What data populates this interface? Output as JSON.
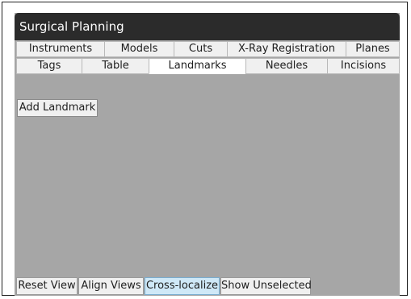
{
  "window": {
    "title": "Surgical Planning"
  },
  "tabs": {
    "row1": [
      {
        "label": "Instruments"
      },
      {
        "label": "Models"
      },
      {
        "label": "Cuts"
      },
      {
        "label": "X-Ray Registration"
      },
      {
        "label": "Planes"
      }
    ],
    "row2": [
      {
        "label": "Tags"
      },
      {
        "label": "Table"
      },
      {
        "label": "Landmarks",
        "active": true
      },
      {
        "label": "Needles"
      },
      {
        "label": "Incisions"
      }
    ]
  },
  "content": {
    "add_landmark_label": "Add Landmark"
  },
  "bottom_buttons": [
    {
      "label": "Reset View"
    },
    {
      "label": "Align Views"
    },
    {
      "label": "Cross-localize",
      "highlighted": true
    },
    {
      "label": "Show Unselected"
    }
  ],
  "colors": {
    "titlebar": "#2b2b2b",
    "panel_background": "#a6a6a6",
    "highlight_button": "#cfe8f7"
  }
}
